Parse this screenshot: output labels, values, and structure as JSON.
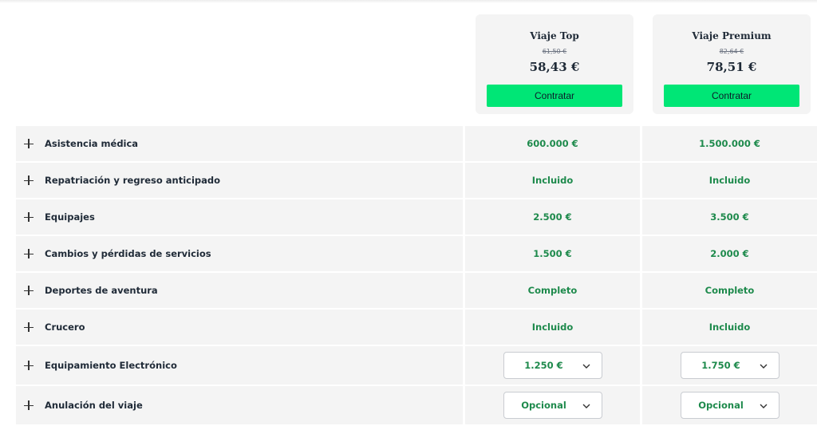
{
  "plans": [
    {
      "name": "Viaje Top",
      "old_price": "61,50 €",
      "price": "58,43 €",
      "button": "Contratar"
    },
    {
      "name": "Viaje Premium",
      "old_price": "82,64 €",
      "price": "78,51 €",
      "button": "Contratar"
    }
  ],
  "rows": [
    {
      "label": "Asistencia médica",
      "top": "600.000 €",
      "premium": "1.500.000 €"
    },
    {
      "label": "Repatriación y regreso anticipado",
      "top": "Incluido",
      "premium": "Incluido"
    },
    {
      "label": "Equipajes",
      "top": "2.500 €",
      "premium": "3.500 €"
    },
    {
      "label": "Cambios y pérdidas de servicios",
      "top": "1.500 €",
      "premium": "2.000 €"
    },
    {
      "label": "Deportes de aventura",
      "top": "Completo",
      "premium": "Completo"
    },
    {
      "label": "Crucero",
      "top": "Incluido",
      "premium": "Incluido"
    },
    {
      "label": "Equipamiento Electrónico",
      "top": "1.250 €",
      "premium": "1.750 €"
    },
    {
      "label": "Anulación del viaje",
      "top": "Opcional",
      "premium": "Opcional"
    }
  ],
  "icons": {
    "expand": "plus-icon",
    "dropdown": "chevron-down-icon"
  },
  "colors": {
    "accent_button": "#00e676",
    "value_text": "#1e8a4c",
    "row_bg": "#f4f4f4"
  }
}
